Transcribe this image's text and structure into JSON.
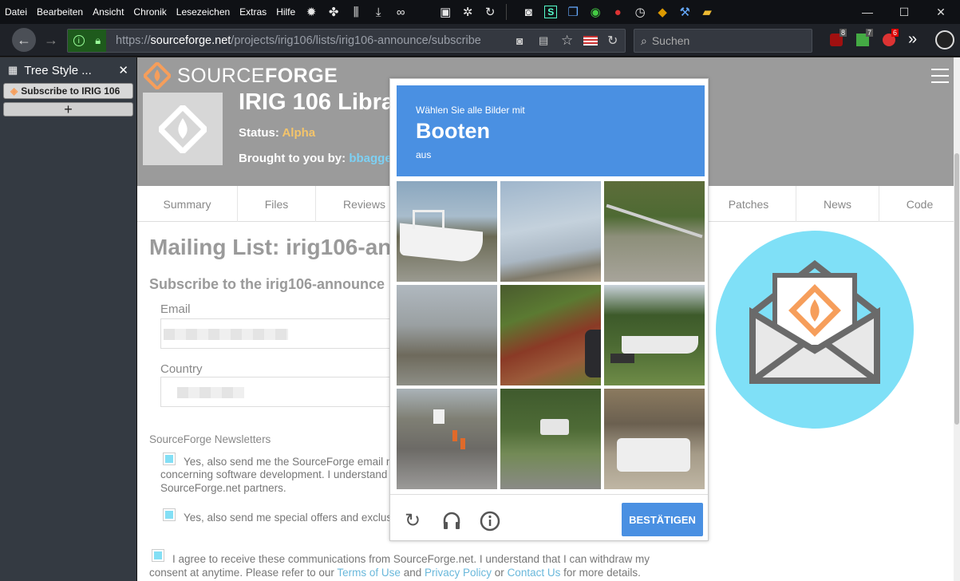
{
  "menubar": {
    "items": [
      "Datei",
      "Bearbeiten",
      "Ansicht",
      "Chronik",
      "Lesezeichen",
      "Extras",
      "Hilfe"
    ]
  },
  "addressbar": {
    "url_prefix": "https://",
    "url_domain": "sourceforge.net",
    "url_path": "/projects/irig106/lists/irig106-announce/subscribe",
    "search_placeholder": "Suchen"
  },
  "toolbar_badges": {
    "ublock": "8",
    "ext2": "7",
    "ext3": "6"
  },
  "sidebar": {
    "title": "Tree Style ...",
    "tab_label": "Subscribe to IRIG 106",
    "new_tab": "+"
  },
  "page": {
    "logo_source": "SOURCE",
    "logo_forge": "FORGE",
    "project_title": "IRIG 106 Libra",
    "status_label": "Status:",
    "status_value": "Alpha",
    "brought_label": "Brought to you by:",
    "brought_value": "bbagger",
    "tabs": [
      "Summary",
      "Files",
      "Reviews",
      "Patches",
      "News",
      "Code"
    ],
    "mailing_title": "Mailing List: irig106-an",
    "subscribe_title": "Subscribe to the irig106-announce list",
    "email_label": "Email",
    "country_label": "Country",
    "newsletters_label": "SourceForge Newsletters",
    "nl1_line1": "Yes, also send me the SourceForge email ne",
    "nl1_line2": "concerning software development. I understand",
    "nl1_line3": "SourceForge.net partners.",
    "nl2": "Yes, also send me special offers and exclusi",
    "agree_line1": "I agree to receive these communications from SourceForge.net. I understand that I can withdraw my",
    "agree_line2_a": "consent at anytime. Please refer to our",
    "terms": "Terms of Use",
    "and": "and",
    "privacy": "Privacy Policy",
    "or": "or",
    "contact": "Contact Us",
    "agree_end": "for more details."
  },
  "captcha": {
    "instruction": "Wählen Sie alle Bilder mit",
    "target": "Booten",
    "suffix": "aus",
    "verify_label": "BESTÄTIGEN"
  },
  "colors": {
    "captcha_blue": "#4a90e2",
    "sf_orange": "#f69e5b",
    "status_alpha": "#f4c46a",
    "link": "#6ab8db",
    "circle": "#7fe0f7"
  }
}
